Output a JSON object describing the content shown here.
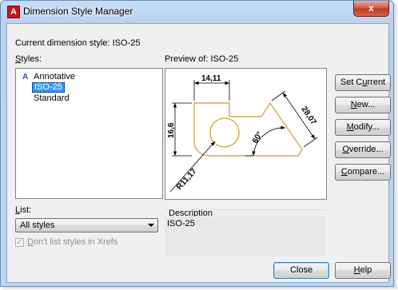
{
  "window": {
    "title": "Dimension Style Manager",
    "app_icon_letter": "A",
    "close_glyph": "x"
  },
  "current_style": {
    "label": "Current dimension style: ISO-25"
  },
  "styles": {
    "label_mnemonic": "S",
    "label_rest": "tyles:",
    "items": [
      {
        "label": "Annotative",
        "icon": "annotative-icon",
        "selected": false
      },
      {
        "label": "ISO-25",
        "selected": true
      },
      {
        "label": "Standard",
        "selected": false
      }
    ]
  },
  "preview": {
    "label": "Preview of: ISO-25",
    "dims": {
      "top": "14,11",
      "left": "16,6",
      "diag": "28,07",
      "angle": "60°",
      "radius": "R11,17"
    }
  },
  "buttons": [
    {
      "name": "set-current-button",
      "pre": "Set C",
      "mn": "u",
      "post": "rrent"
    },
    {
      "name": "new-button",
      "pre": "",
      "mn": "N",
      "post": "ew..."
    },
    {
      "name": "modify-button",
      "pre": "",
      "mn": "M",
      "post": "odify..."
    },
    {
      "name": "override-button",
      "pre": "",
      "mn": "O",
      "post": "verride..."
    },
    {
      "name": "compare-button",
      "pre": "",
      "mn": "C",
      "post": "ompare..."
    }
  ],
  "list": {
    "label_mnemonic": "L",
    "label_rest": "ist:",
    "selected": "All styles"
  },
  "xrefs": {
    "mnemonic": "D",
    "rest": "on't list styles in Xrefs",
    "checked": true,
    "check_glyph": "✓"
  },
  "description": {
    "title": "Description",
    "text": "ISO-25"
  },
  "footer": {
    "close_label": "Close",
    "help_mnemonic": "H",
    "help_rest": "elp"
  },
  "colors": {
    "selection": "#3399ff",
    "geometry": "#c9a227",
    "accent": "#3c7fb1"
  }
}
